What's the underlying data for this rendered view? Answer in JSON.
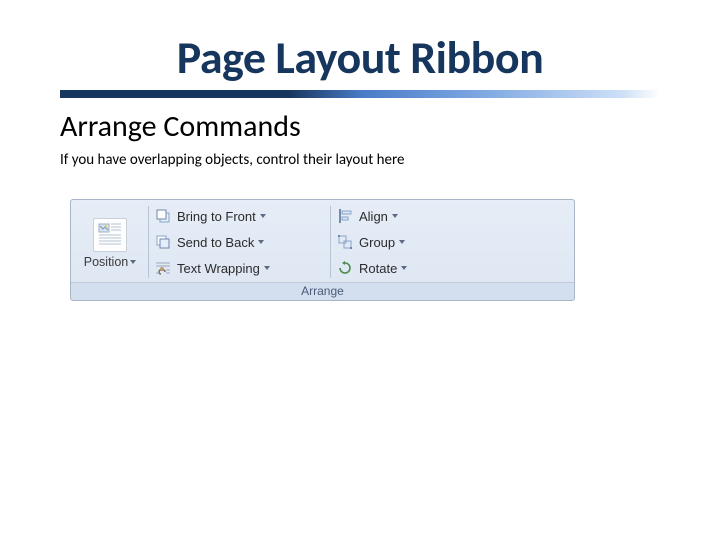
{
  "title": "Page Layout Ribbon",
  "subtitle": "Arrange Commands",
  "description": "If you have overlapping objects, control their layout here",
  "ribbon": {
    "group_label": "Arrange",
    "position": {
      "label": "Position"
    },
    "commands_mid": [
      {
        "label": "Bring to Front"
      },
      {
        "label": "Send to Back"
      },
      {
        "label": "Text Wrapping"
      }
    ],
    "commands_right": [
      {
        "label": "Align"
      },
      {
        "label": "Group"
      },
      {
        "label": "Rotate"
      }
    ]
  }
}
